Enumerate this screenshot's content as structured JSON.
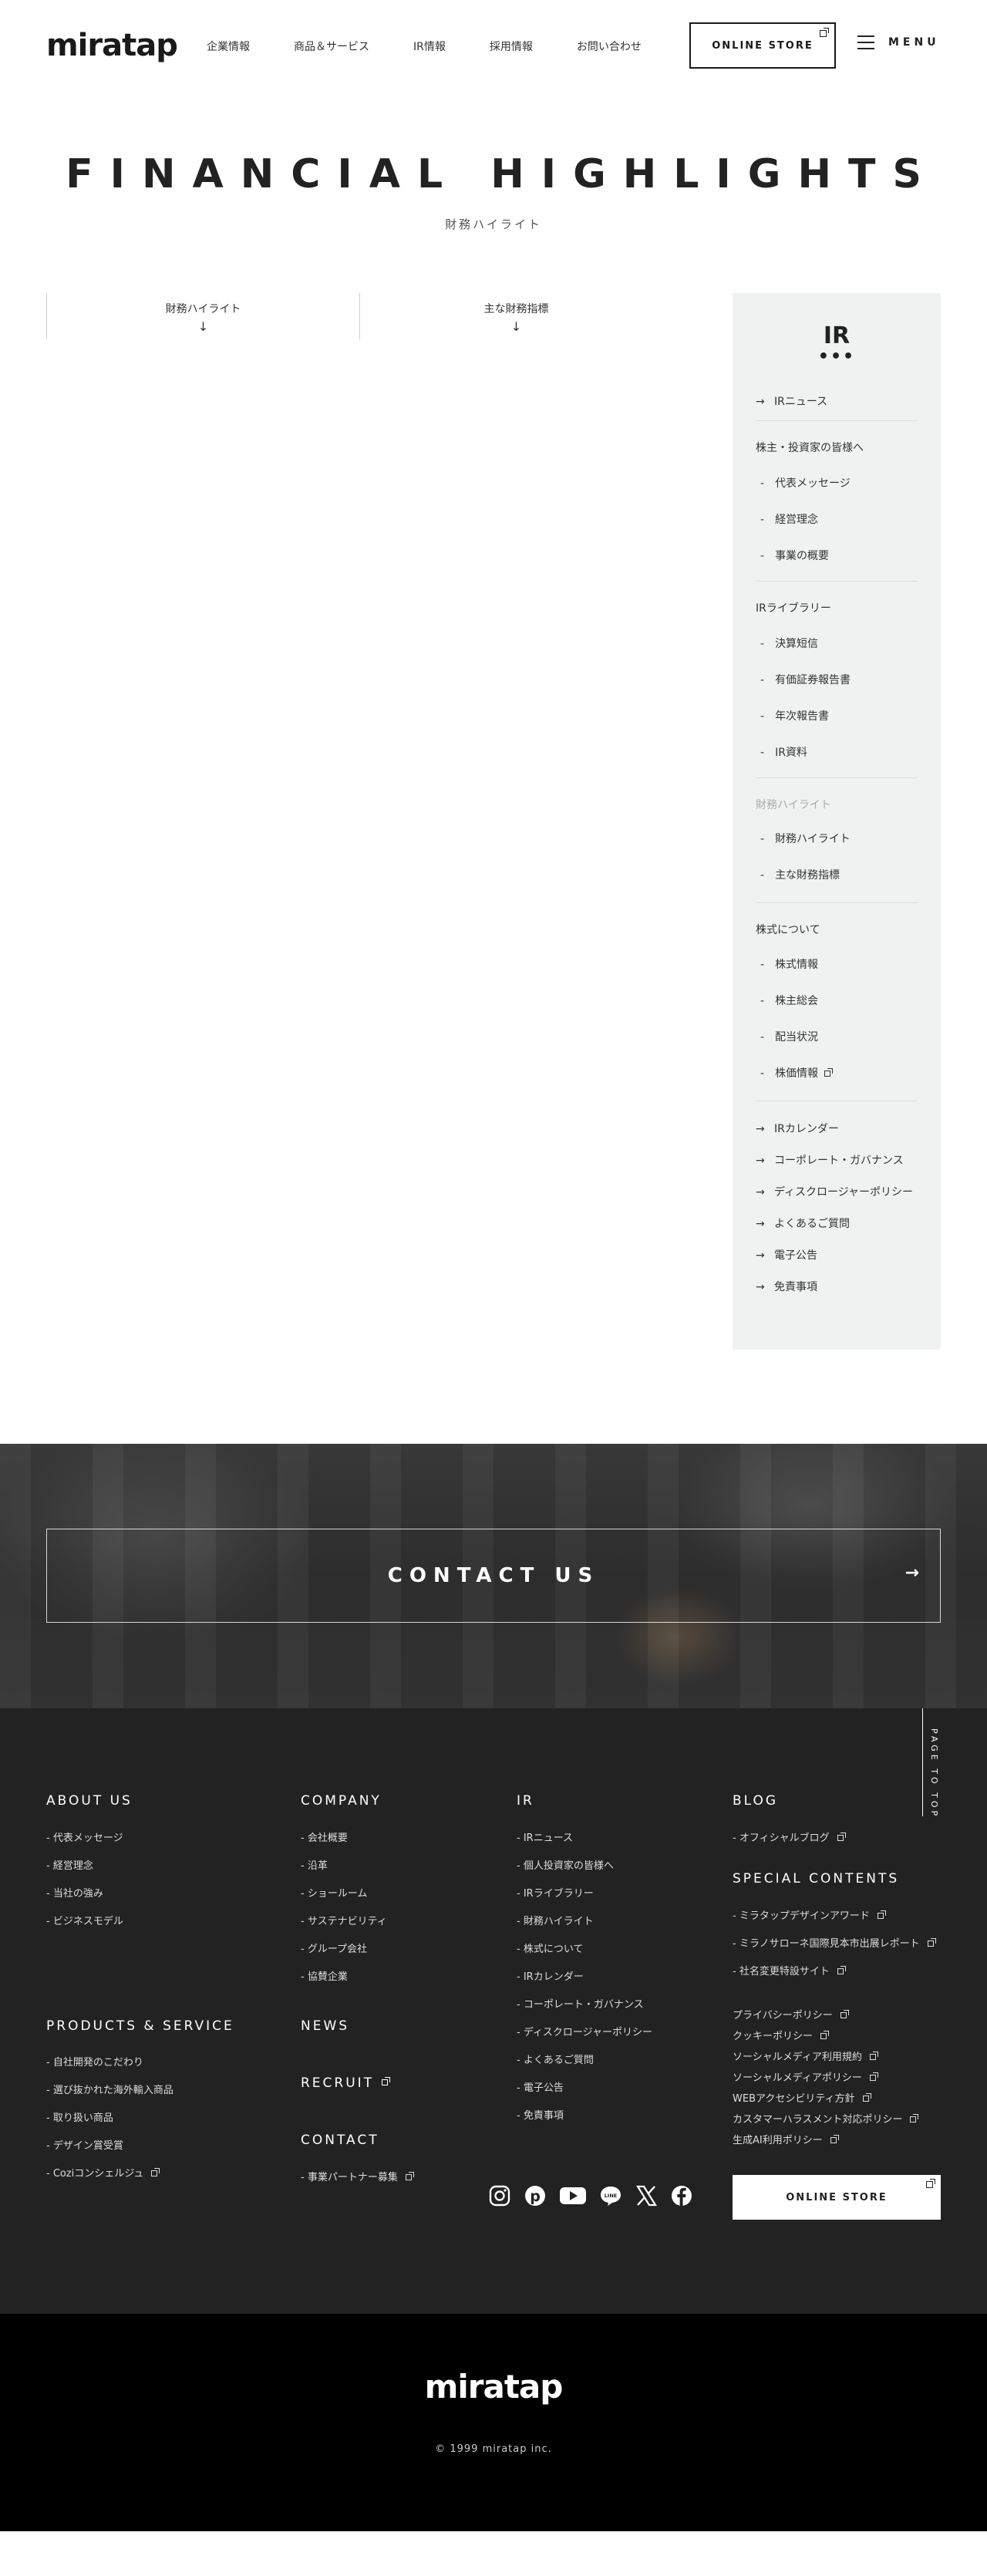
{
  "header": {
    "logo": "miratap",
    "nav": [
      "企業情報",
      "商品＆サービス",
      "IR情報",
      "採用情報",
      "お問い合わせ"
    ],
    "store": "ONLINE STORE",
    "menu": "MENU"
  },
  "title": {
    "main": "FINANCIAL HIGHLIGHTS",
    "sub": "財務ハイライト"
  },
  "anchors": [
    {
      "label": "財務ハイライト",
      "arrow": "↓"
    },
    {
      "label": "主な財務指標",
      "arrow": "↓"
    }
  ],
  "sidebar": {
    "title": "IR",
    "dots": "•••",
    "ir_news": "IRニュース",
    "group1": {
      "heading": "株主・投資家の皆様へ",
      "items": [
        "代表メッセージ",
        "経営理念",
        "事業の概要"
      ]
    },
    "group2": {
      "heading": "IRライブラリー",
      "items": [
        "決算短信",
        "有価証券報告書",
        "年次報告書",
        "IR資料"
      ]
    },
    "group3": {
      "heading": "財務ハイライト",
      "items": [
        "財務ハイライト",
        "主な財務指標"
      ]
    },
    "group4": {
      "heading": "株式について",
      "items": [
        "株式情報",
        "株主総会",
        "配当状況",
        "株価情報"
      ]
    },
    "links": [
      "IRカレンダー",
      "コーポレート・ガバナンス",
      "ディスクロージャーポリシー",
      "よくあるご質問",
      "電子公告",
      "免責事項"
    ]
  },
  "contact": {
    "label": "CONTACT US",
    "arrow": "→"
  },
  "footer": {
    "page_to_top": "PAGE TO TOP",
    "about": {
      "heading": "ABOUT US",
      "items": [
        "- 代表メッセージ",
        "- 経営理念",
        "- 当社の強み",
        "- ビジネスモデル"
      ]
    },
    "company": {
      "heading": "COMPANY",
      "items": [
        "- 会社概要",
        "- 沿革",
        "- ショールーム",
        "- サステナビリティ",
        "- グループ会社",
        "- 協賛企業"
      ]
    },
    "ir": {
      "heading": "IR",
      "items": [
        "- IRニュース",
        "- 個人投資家の皆様へ",
        "- IRライブラリー",
        "- 財務ハイライト",
        "- 株式について",
        "- IRカレンダー",
        "- コーポレート・ガバナンス",
        "- ディスクロージャーポリシー",
        "- よくあるご質問",
        "- 電子公告",
        "- 免責事項"
      ]
    },
    "blog": {
      "heading": "BLOG",
      "items": [
        "- オフィシャルブログ"
      ]
    },
    "special": {
      "heading": "SPECIAL CONTENTS",
      "items": [
        "- ミラタップデザインアワード",
        "- ミラノサローネ国際見本市出展レポート",
        "- 社名変更特設サイト"
      ]
    },
    "policies": [
      "プライバシーポリシー",
      "クッキーポリシー",
      "ソーシャルメディア利用規約",
      "ソーシャルメディアポリシー",
      "WEBアクセシビリティ方針",
      "カスタマーハラスメント対応ポリシー",
      "生成AI利用ポリシー"
    ],
    "products": {
      "heading": "PRODUCTS & SERVICE",
      "items": [
        "- 自社開発のこだわり",
        "- 選び抜かれた海外輸入商品",
        "- 取り扱い商品",
        "- デザイン賞受賞",
        "- Coziコンシェルジュ"
      ]
    },
    "news": "NEWS",
    "recruit": "RECRUIT",
    "contact": {
      "heading": "CONTACT",
      "items": [
        "- 事業パートナー募集"
      ]
    },
    "store": "ONLINE STORE",
    "social_icons": [
      "instagram-icon",
      "pinterest-icon",
      "youtube-icon",
      "line-icon",
      "x-icon",
      "facebook-icon"
    ]
  },
  "bottom": {
    "logo": "miratap",
    "copyright": "© 1999 miratap inc."
  }
}
